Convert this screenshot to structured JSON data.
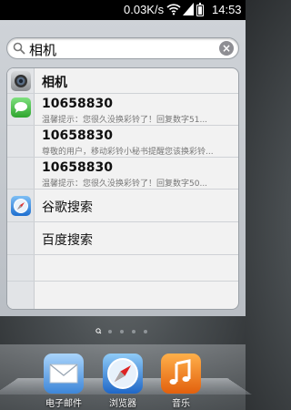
{
  "status_bar": {
    "network_speed": "0.03K/s",
    "time": "14:53",
    "battery_level": 0.85
  },
  "search": {
    "query": "相机"
  },
  "results": [
    {
      "icon": "camera-icon",
      "title": "相机"
    },
    {
      "icon": "messages-icon",
      "title": "10658830",
      "snippet": "温馨提示：您很久没换彩铃了！回复数字51..."
    },
    {
      "title": "10658830",
      "snippet": "尊敬的用户，移动彩铃小秘书提醒您该换彩铃..."
    },
    {
      "title": "10658830",
      "snippet": "温馨提示：您很久没换彩铃了！回复数字50..."
    },
    {
      "icon": "safari-compass-icon",
      "title": "谷歌搜索"
    },
    {
      "title": "百度搜索"
    }
  ],
  "pager": {
    "pages": 4,
    "search_page_active": true
  },
  "dock": [
    {
      "icon": "mail-icon",
      "label": "电子邮件"
    },
    {
      "icon": "browser-compass-icon",
      "label": "浏览器"
    },
    {
      "icon": "music-icon",
      "label": "音乐"
    }
  ],
  "colors": {
    "messages_green": "#3cc33c",
    "music_orange": "#f07a1a",
    "mail_blue": "#5ca6e8"
  }
}
